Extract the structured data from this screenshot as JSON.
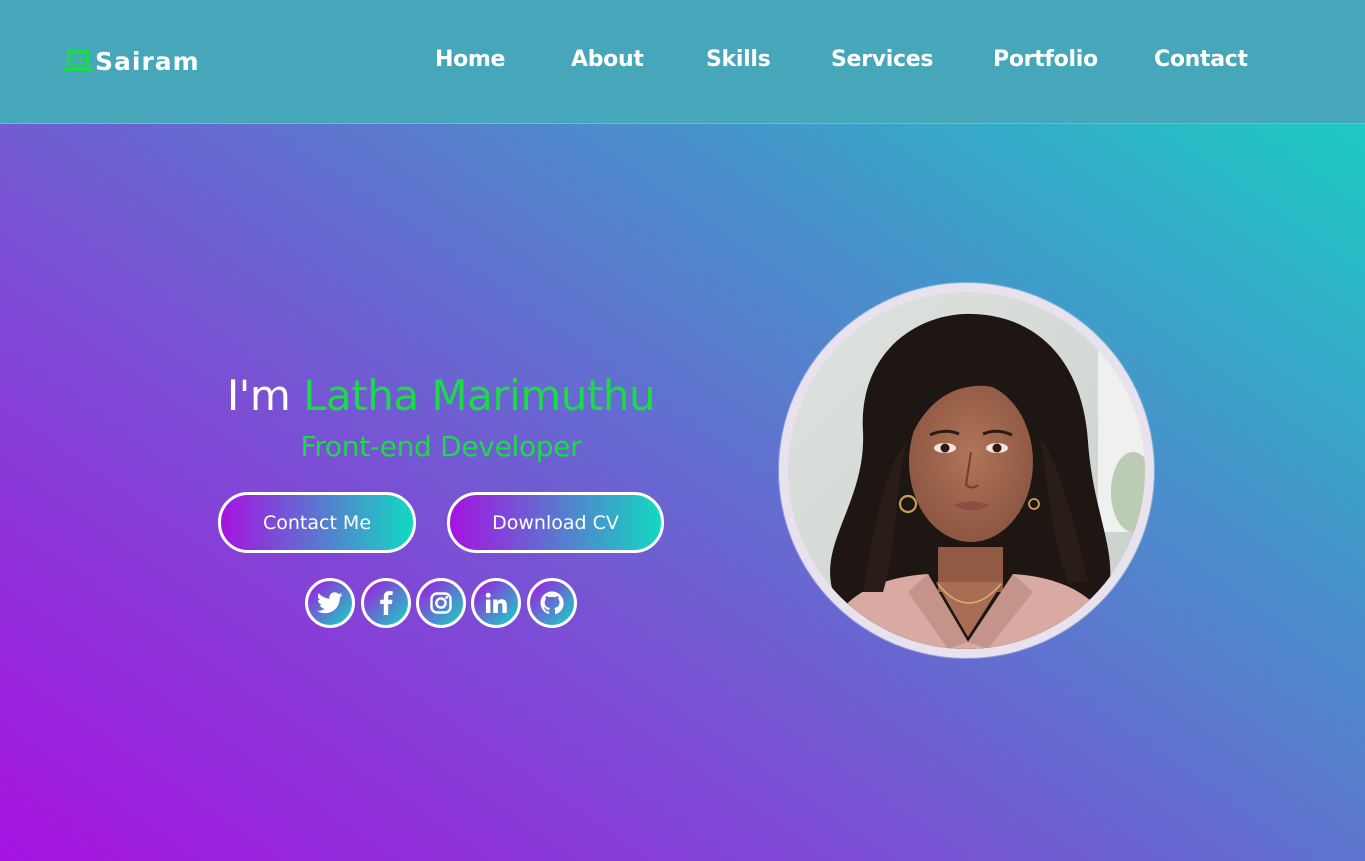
{
  "brand": {
    "name": "Sairam",
    "icon": "laptop-code-icon",
    "accent_color": "#1bdb46"
  },
  "nav": {
    "items": [
      {
        "label": "Home"
      },
      {
        "label": "About"
      },
      {
        "label": "Skills"
      },
      {
        "label": "Services"
      },
      {
        "label": "Portfolio"
      },
      {
        "label": "Contact"
      }
    ]
  },
  "hero": {
    "greeting": "I'm",
    "name": "Latha Marimuthu",
    "role": "Front-end Developer",
    "buttons": {
      "contact_label": "Contact Me",
      "cv_label": "Download CV"
    },
    "socials": [
      {
        "icon": "twitter-icon"
      },
      {
        "icon": "facebook-icon"
      },
      {
        "icon": "instagram-icon"
      },
      {
        "icon": "linkedin-icon"
      },
      {
        "icon": "github-icon"
      }
    ]
  },
  "colors": {
    "navbar_bg": "#45a7b9",
    "gradient_start": "#a612e0",
    "gradient_end": "#12d9c2",
    "text": "#ffffff"
  }
}
